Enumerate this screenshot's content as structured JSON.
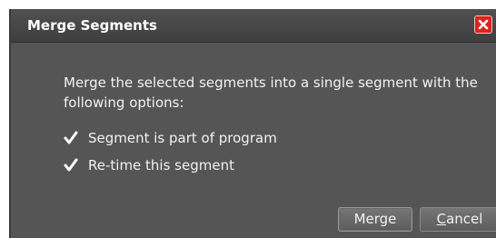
{
  "dialog": {
    "title": "Merge Segments",
    "close_icon": "close-icon",
    "message": "Merge the selected segments into a single segment with the following options:",
    "options": [
      {
        "label": "Segment is part of program",
        "checked": true
      },
      {
        "label": "Re-time this segment",
        "checked": true
      }
    ],
    "buttons": {
      "merge_label": "Merge",
      "cancel_label_first": "C",
      "cancel_label_rest": "ancel"
    }
  },
  "colors": {
    "background": "#555555",
    "titlebar": "#464646",
    "close_button": "#d9241e",
    "text": "#f2f2f2"
  }
}
